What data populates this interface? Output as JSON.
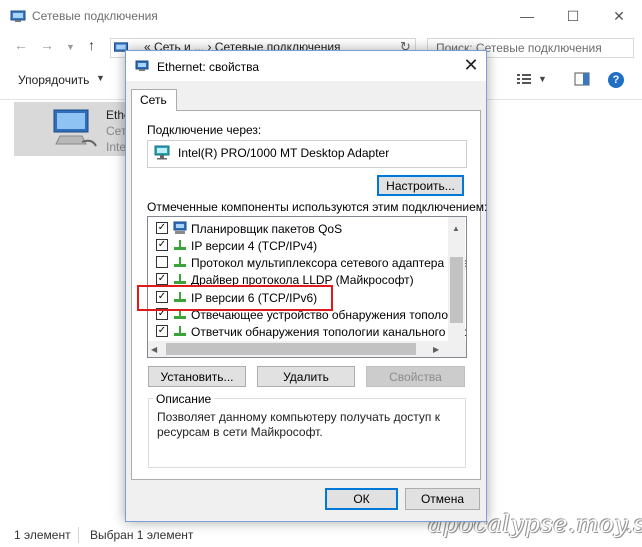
{
  "explorer": {
    "title": "Сетевые подключения",
    "address": {
      "prefix": "«",
      "crumb1": "Сеть и ...",
      "separator": "›",
      "crumb2": "Сетевые подключения"
    },
    "search_placeholder": "Поиск: Сетевые подключения",
    "organize_label": "Упорядочить",
    "selected_item": {
      "name": "Ethe",
      "line2": "Сете",
      "line3": "Inte"
    },
    "status": {
      "count": "1 элемент",
      "selected": "Выбран 1 элемент"
    }
  },
  "dialog": {
    "title": "Ethernet: свойства",
    "tab": "Сеть",
    "connect_using_label": "Подключение через:",
    "adapter": "Intel(R) PRO/1000 MT Desktop Adapter",
    "configure_button": "Настроить...",
    "components_label": "Отмеченные компоненты используются этим подключением:",
    "components": [
      {
        "label": "Планировщик пакетов QoS",
        "checked": true,
        "icon": "qos-scheduler-icon"
      },
      {
        "label": "IP версии 4 (TCP/IPv4)",
        "checked": true,
        "icon": "protocol-icon"
      },
      {
        "label": "Протокол мультиплексора сетевого адаптера (Май",
        "checked": false,
        "icon": "protocol-icon"
      },
      {
        "label": "Драйвер протокола LLDP (Майкрософт)",
        "checked": true,
        "icon": "protocol-icon"
      },
      {
        "label": "IP версии 6 (TCP/IPv6)",
        "checked": true,
        "icon": "protocol-icon"
      },
      {
        "label": "Отвечающее устройство обнаружения топологии к",
        "checked": true,
        "icon": "protocol-icon"
      },
      {
        "label": "Ответчик обнаружения топологии канального уров",
        "checked": true,
        "icon": "protocol-icon"
      }
    ],
    "install_button": "Установить...",
    "uninstall_button": "Удалить",
    "properties_button": "Свойства",
    "description_title": "Описание",
    "description_text": "Позволяет данному компьютеру получать доступ к ресурсам в сети Майкрософт.",
    "ok_button": "ОК",
    "cancel_button": "Отмена"
  },
  "watermark": "apocalypse.moy.su",
  "colors": {
    "highlight_box": "#e01a1a",
    "dialog_border": "#7a9fd4",
    "protocol_icon": "#3aa33a"
  }
}
